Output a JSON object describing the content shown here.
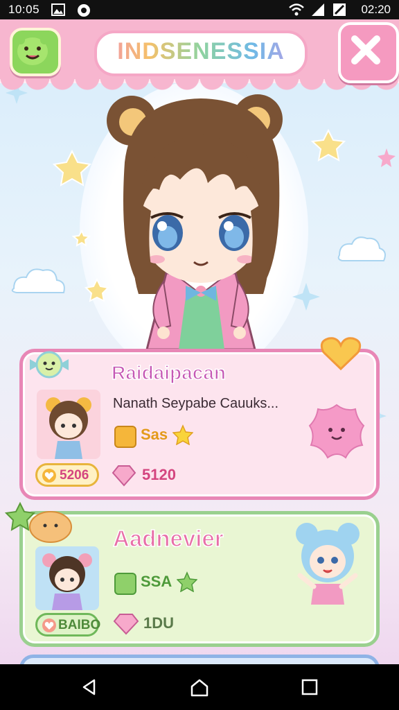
{
  "status_bar": {
    "time": "10:05",
    "clock": "02:20"
  },
  "header": {
    "title": "INDSENESSIA"
  },
  "cards": [
    {
      "title": "Raidaipacan",
      "subtitle": "Nanath Seypabe Cauuks...",
      "stat_label": "Sas",
      "coins": "5206",
      "gems": "5120"
    },
    {
      "title": "Aadnevier",
      "stat_label": "SSA",
      "coins": "BAIBO",
      "gems": "1DU"
    }
  ],
  "colors": {
    "header": "#f7b6cf",
    "card1_border": "#e887b6",
    "card2_border": "#9ad08f",
    "accent_pink": "#ef6aa6"
  }
}
